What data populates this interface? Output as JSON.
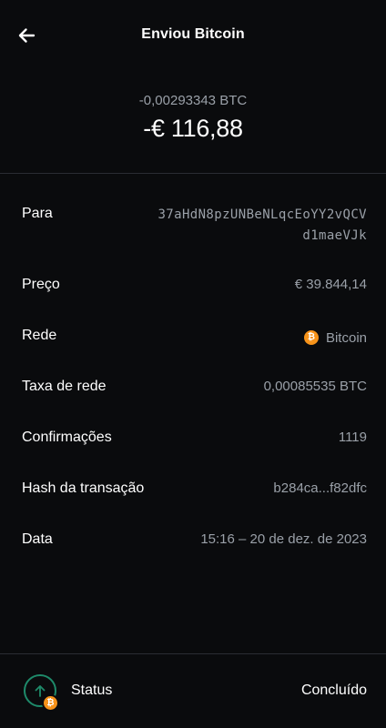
{
  "header": {
    "title": "Enviou Bitcoin",
    "back_icon": "arrow-left-icon"
  },
  "amount": {
    "crypto": "-0,00293343 BTC",
    "fiat": "-€ 116,88"
  },
  "details": {
    "para": {
      "label": "Para",
      "value_line1": "37aHdN8pzUNBeNLqcEoYY2vQCV",
      "value_line2": "d1maeVJk"
    },
    "preco": {
      "label": "Preço",
      "value": "€ 39.844,14"
    },
    "rede": {
      "label": "Rede",
      "value": "Bitcoin",
      "icon": "bitcoin-icon",
      "icon_glyph": "₿"
    },
    "taxa": {
      "label": "Taxa de rede",
      "value": "0,00085535 BTC"
    },
    "confirmacoes": {
      "label": "Confirmações",
      "value": "1119"
    },
    "hash": {
      "label": "Hash da transação",
      "value": "b284ca...f82dfc"
    },
    "data": {
      "label": "Data",
      "value": "15:16 – 20 de dez. de 2023"
    }
  },
  "status": {
    "label": "Status",
    "value": "Concluído",
    "icon": "send-arrow-up-icon",
    "badge_glyph": "₿"
  },
  "colors": {
    "background": "#0a0b0d",
    "muted_text": "#9aa0a8",
    "divider": "#2a2d33",
    "bitcoin_orange": "#f7931a",
    "status_green": "#1e8a6a"
  }
}
